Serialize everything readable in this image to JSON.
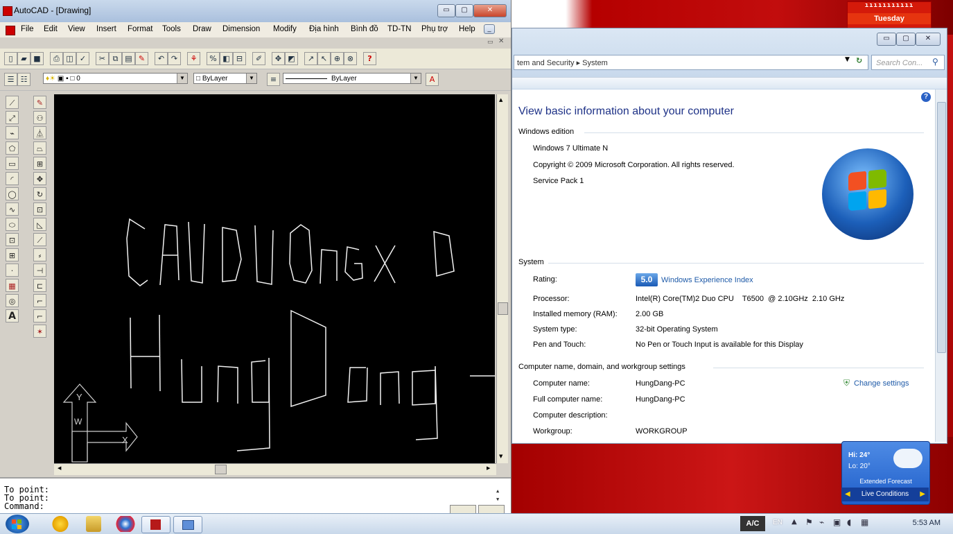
{
  "desktop": {
    "calendar_day": "Tuesday",
    "calendar_rings": "ııııııııııı"
  },
  "autocad": {
    "title": "AutoCAD - [Drawing]",
    "menu": [
      "File",
      "Edit",
      "View",
      "Insert",
      "Format",
      "Tools",
      "Draw",
      "Dimension",
      "Modify",
      "Địa hình",
      "Bình đồ",
      "TD-TN",
      "Phụ trợ",
      "Help"
    ],
    "layer_dropdown": "0",
    "color_dropdown": "ByLayer",
    "linetype_dropdown": "ByLayer",
    "ucs_labels": {
      "y": "Y",
      "x": "X",
      "w": "W"
    },
    "command_lines": [
      "To point:",
      "To point:",
      "Command:"
    ]
  },
  "system": {
    "breadcrumb": "tem and Security ▸ System",
    "search_placeholder": "Search Con...",
    "heading": "View basic information about your computer",
    "edition_section": "Windows edition",
    "edition": "Windows 7 Ultimate N",
    "copyright": "Copyright © 2009 Microsoft Corporation.  All rights reserved.",
    "service_pack": "Service Pack 1",
    "system_section": "System",
    "rating_label": "Rating:",
    "rating_value": "5.0",
    "rating_link": "Windows Experience Index",
    "processor_label": "Processor:",
    "processor_value": "Intel(R) Core(TM)2 Duo CPU    T6500  @ 2.10GHz  2.10 GHz",
    "ram_label": "Installed memory (RAM):",
    "ram_value": "2.00 GB",
    "systype_label": "System type:",
    "systype_value": "32-bit Operating System",
    "pen_label": "Pen and Touch:",
    "pen_value": "No Pen or Touch Input is available for this Display",
    "computer_section": "Computer name, domain, and workgroup settings",
    "compname_label": "Computer name:",
    "compname_value": "HungDang-PC",
    "fullname_label": "Full computer name:",
    "fullname_value": "HungDang-PC",
    "desc_label": "Computer description:",
    "workgroup_label": "Workgroup:",
    "workgroup_value": "WORKGROUP",
    "change_settings": "Change settings"
  },
  "weather": {
    "hi": "Hi: 24°",
    "lo": "Lo: 20°",
    "extended": "Extended Forecast",
    "live": "Live Conditions"
  },
  "taskbar": {
    "ac_badge": "A/C",
    "lang": "EN",
    "clock": "5:53 AM"
  }
}
